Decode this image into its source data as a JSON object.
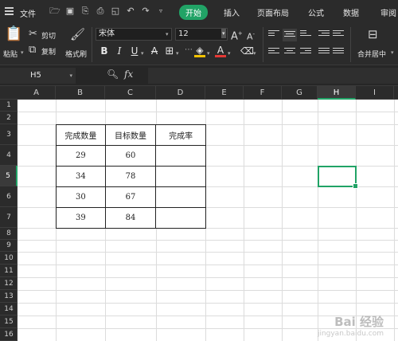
{
  "menubar": {
    "file": "文件",
    "tabs": [
      "开始",
      "插入",
      "页面布局",
      "公式",
      "数据",
      "审阅"
    ],
    "active_tab": "开始",
    "accent": "#21a366"
  },
  "ribbon": {
    "paste": "粘贴",
    "cut": "剪切",
    "copy": "复制",
    "format_painter": "格式刷",
    "font_name": "宋体",
    "font_size": "12",
    "merge_center": "合并居中"
  },
  "formula_bar": {
    "cell_ref": "H5",
    "fx_label": "fx"
  },
  "grid": {
    "columns": [
      "A",
      "B",
      "C",
      "D",
      "E",
      "F",
      "G",
      "H",
      "I"
    ],
    "selected_column": "H",
    "rows": [
      "1",
      "2",
      "3",
      "4",
      "5",
      "6",
      "7",
      "8",
      "9",
      "10",
      "11",
      "12",
      "13",
      "14",
      "15",
      "16"
    ],
    "selected_row": "5"
  },
  "table": {
    "headers": [
      "完成数量",
      "目标数量",
      "完成率"
    ],
    "rows": [
      [
        "29",
        "60",
        ""
      ],
      [
        "34",
        "78",
        ""
      ],
      [
        "30",
        "67",
        ""
      ],
      [
        "39",
        "84",
        ""
      ]
    ]
  },
  "watermark": {
    "brand": "Bai 经验",
    "url": "jingyan.baidu.com"
  }
}
